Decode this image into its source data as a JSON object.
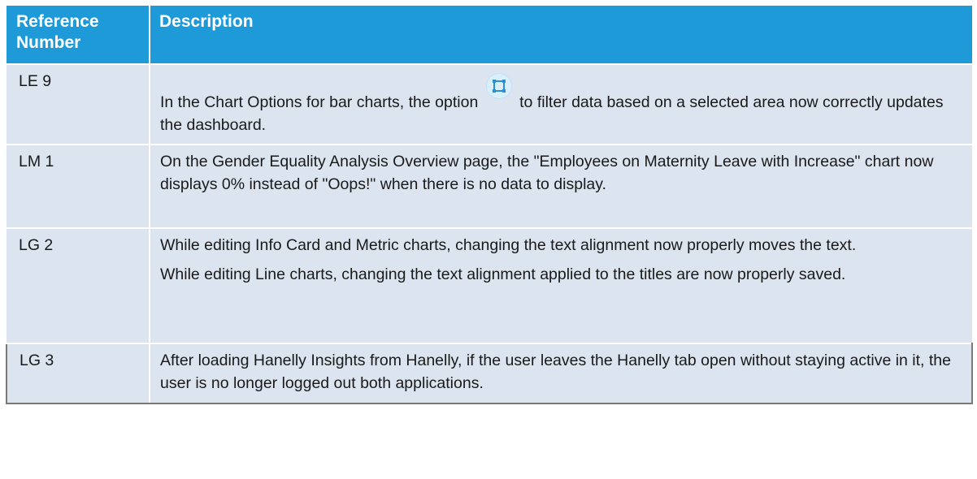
{
  "table": {
    "headers": {
      "ref": "Reference Number",
      "desc": "Description"
    },
    "rows": [
      {
        "ref": "LE 9",
        "desc_before_icon": "In the Chart Options for bar charts, the option",
        "desc_after_icon": "to filter data based on a selected area now correctly updates the dashboard.",
        "icon": "select-area-icon"
      },
      {
        "ref": "LM 1",
        "desc": "On the Gender Equality Analysis Overview page, the \"Employees on Maternity Leave with Increase\" chart now displays 0% instead of \"Oops!\" when there is no data to display."
      },
      {
        "ref": "LG 2",
        "paragraphs": [
          "While editing Info Card and Metric charts, changing the text alignment now properly moves the text.",
          "While editing Line charts, changing the text alignment applied to the titles are now properly saved."
        ]
      },
      {
        "ref": "LG 3",
        "desc": "After loading Hanelly Insights from Hanelly, if the user leaves the Hanelly tab open without staying active in it, the user is no longer logged out both applications."
      }
    ]
  },
  "colors": {
    "header_bg": "#1f9ad8",
    "row_bg": "#dbe4ef",
    "icon_accent": "#2a8fd6"
  }
}
